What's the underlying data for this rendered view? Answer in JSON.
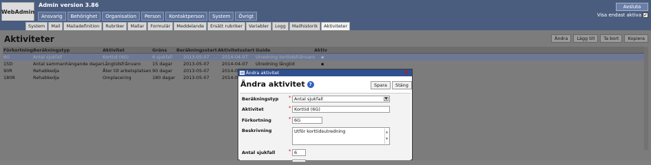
{
  "app": {
    "logo": "WebAdmin",
    "version": "Admin version 3.86",
    "logout_label": "Avsluta",
    "visa_label": "Visa endast aktiva",
    "visa_checked": "✓"
  },
  "main_tabs": [
    "Ansvarig",
    "Behörighet",
    "Organisation",
    "Person",
    "Kontaktperson",
    "System",
    "Övrigt"
  ],
  "sub_tabs": [
    "System",
    "Mail",
    "Mailadefinition",
    "Rubriker",
    "Mallar",
    "Formulär",
    "Meddelande",
    "Ersätt rubriker",
    "Variabler",
    "Logg",
    "Mailhistorik",
    "Aktiviteter"
  ],
  "active_sub_tab": "Aktiviteter",
  "page": {
    "title": "Aktiviteter",
    "actions": [
      "Ändra",
      "Lägg till",
      "Ta bort",
      "Kopiera"
    ]
  },
  "table": {
    "headers": [
      "Förkortning",
      "Beräkningstyp",
      "Aktivitet",
      "Gräns",
      "Beräkningsstart",
      "Aktivitetsstart",
      "Guide",
      "Aktiv"
    ],
    "rows": [
      [
        "6G",
        "Antal sjukfall",
        "Korttid (6G)",
        "6 sjukfall",
        "2013-05-07",
        "2014-04-07",
        "Utredning korttidsfrånvaro",
        "▪"
      ],
      [
        "15D",
        "Antal sammanhängande dagar",
        "Långtidsfrånvaro",
        "15 dagar",
        "2013-05-07",
        "2014-04-07",
        "Utredning långtid",
        "▪"
      ],
      [
        "90R",
        "Rehabkedja",
        "Åter till arbetsplatsen",
        "90 dagar",
        "2013-05-07",
        "2014-0",
        "",
        ""
      ],
      [
        "180R",
        "Rehabkedja",
        "Omplacering",
        "180 dagar",
        "2013-05-07",
        "2014-0",
        "",
        ""
      ]
    ]
  },
  "modal": {
    "window_title": "Ändra aktivitet",
    "close_icon": "✕",
    "heading": "Ändra aktivitet",
    "help_icon": "?",
    "save_label": "Spara",
    "close_label": "Stäng",
    "fields": {
      "berakningstyp_label": "Beräkningstyp",
      "berakningstyp_value": "Antal sjukfall",
      "aktivitet_label": "Aktivitet",
      "aktivitet_value": "Korttid (6G)",
      "forkortning_label": "Förkortning",
      "forkortning_value": "6G",
      "beskrivning_label": "Beskrivning",
      "beskrivning_value": "Utför korttidsutredning",
      "antal_sjukfall_label": "Antal sjukfall",
      "antal_sjukfall_value": "6"
    },
    "required_mark": "*"
  }
}
